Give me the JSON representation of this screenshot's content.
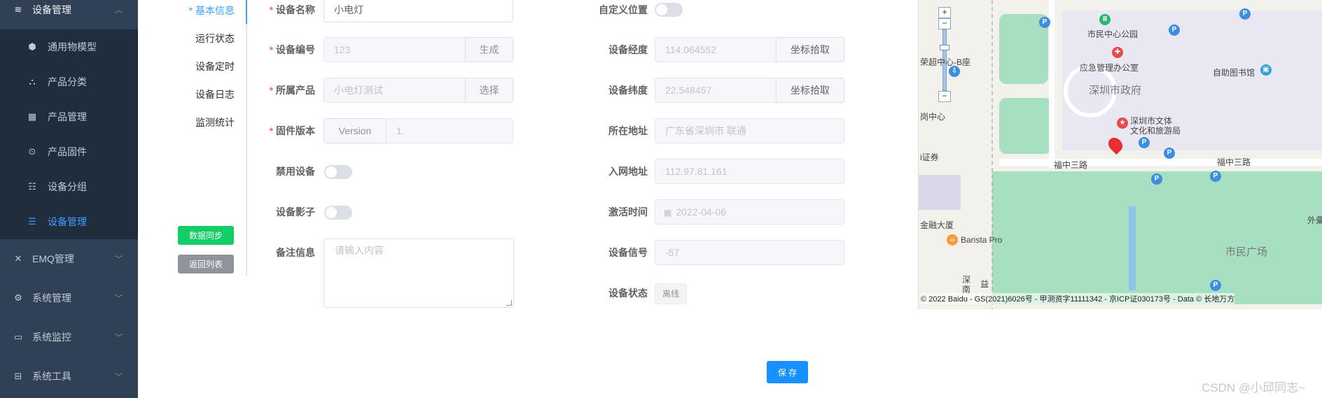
{
  "sidebar": {
    "groups": [
      {
        "label": "设备管理",
        "icon": "layers-icon",
        "expanded": true
      },
      {
        "label": "EMQ管理",
        "icon": "emq-icon"
      },
      {
        "label": "系统管理",
        "icon": "gear-icon"
      },
      {
        "label": "系统监控",
        "icon": "monitor-icon"
      },
      {
        "label": "系统工具",
        "icon": "toolbox-icon"
      }
    ],
    "items": [
      {
        "label": "通用物模型",
        "icon": "cube-icon"
      },
      {
        "label": "产品分类",
        "icon": "tree-icon"
      },
      {
        "label": "产品管理",
        "icon": "grid-icon"
      },
      {
        "label": "产品固件",
        "icon": "firmware-icon"
      },
      {
        "label": "设备分组",
        "icon": "group-icon"
      },
      {
        "label": "设备管理",
        "icon": "device-list-icon",
        "active": true
      }
    ]
  },
  "tabs": [
    {
      "label": "* 基本信息",
      "active": true
    },
    {
      "label": "运行状态"
    },
    {
      "label": "设备定时"
    },
    {
      "label": "设备日志"
    },
    {
      "label": "监测统计"
    }
  ],
  "side_buttons": {
    "sync": "数据同步",
    "back": "返回列表"
  },
  "form_left": {
    "device_name": {
      "label": "设备名称",
      "value": "小电灯"
    },
    "device_no": {
      "label": "设备编号",
      "value": "123",
      "append": "生成"
    },
    "product": {
      "label": "所属产品",
      "value": "小电灯测试",
      "append": "选择"
    },
    "firmware": {
      "label": "固件版本",
      "prepend": "Version",
      "value": "1"
    },
    "disable": {
      "label": "禁用设备"
    },
    "shadow": {
      "label": "设备影子"
    },
    "remark": {
      "label": "备注信息",
      "placeholder": "请输入内容"
    }
  },
  "form_right": {
    "custom_pos": {
      "label": "自定义位置"
    },
    "longitude": {
      "label": "设备经度",
      "value": "114.064552",
      "append": "坐标拾取"
    },
    "latitude": {
      "label": "设备纬度",
      "value": "22.548457",
      "append": "坐标拾取"
    },
    "address": {
      "label": "所在地址",
      "value": "广东省深圳市 联通"
    },
    "network": {
      "label": "入网地址",
      "value": "112.97.81.161"
    },
    "activation": {
      "label": "激活时间",
      "value": "2022-04-06"
    },
    "signal": {
      "label": "设备信号",
      "value": "-57"
    },
    "status": {
      "label": "设备状态",
      "value": "离线"
    }
  },
  "save_label": "保 存",
  "watermark": "CSDN @小邱同志~",
  "map": {
    "labels": {
      "park": "市民中心公园",
      "emergency": "应急管理办公室",
      "gov": "深圳市政府",
      "library": "自助图书馆",
      "culture1": "深圳市文体",
      "culture2": "文化和旅游局",
      "road1": "福中三路",
      "road2": "福中三路",
      "square": "市民广场",
      "outer": "外彙",
      "rongchao": "荣超中心-B座",
      "center": "岗中心",
      "security": "i证券",
      "finance": "金融大厦",
      "barista": "Barista Pro",
      "shen": "深",
      "nan": "南",
      "yi": "益"
    },
    "copyright": "© 2022 Baidu - GS(2021)6026号 - 甲测资字11111342 - 京ICP证030173号 - Data © 长地万方"
  }
}
